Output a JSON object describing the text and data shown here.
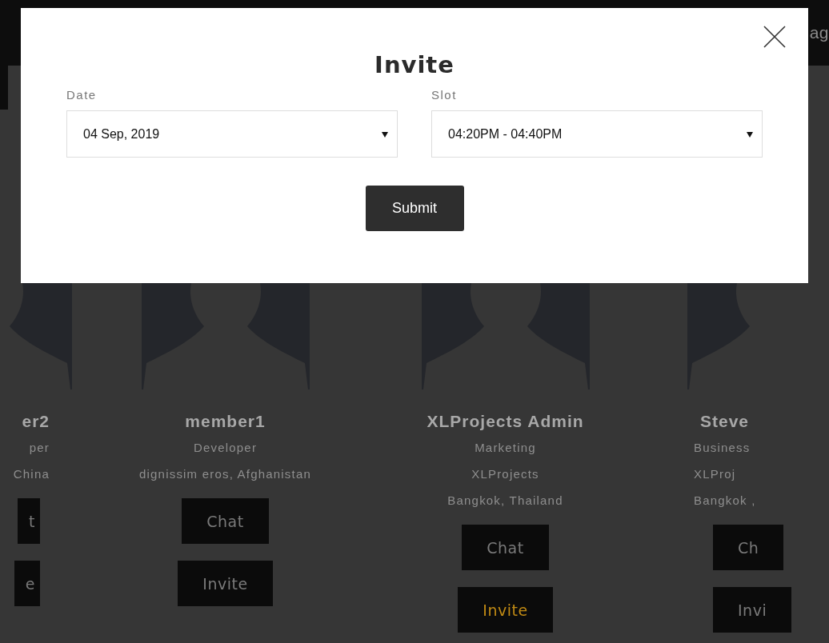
{
  "header": {
    "text": "ag"
  },
  "cards": [
    {
      "kind": "cut-left",
      "name": "er2",
      "lines": [
        "per",
        "China"
      ],
      "buttons": [
        {
          "label": "t",
          "selected": false
        },
        {
          "label": "e",
          "selected": false
        }
      ]
    },
    {
      "kind": "full",
      "name": "member1",
      "lines": [
        "Developer",
        "dignissim eros, Afghanistan"
      ],
      "buttons": [
        {
          "label": "Chat",
          "selected": false
        },
        {
          "label": "Invite",
          "selected": false
        }
      ]
    },
    {
      "kind": "full",
      "name": "XLProjects Admin",
      "lines": [
        "Marketing",
        "XLProjects",
        "Bangkok, Thailand"
      ],
      "buttons": [
        {
          "label": "Chat",
          "selected": false
        },
        {
          "label": "Invite",
          "selected": true
        }
      ]
    },
    {
      "kind": "cut-right",
      "name": "Steve",
      "lines": [
        "Business",
        "XLProj",
        "Bangkok ,"
      ],
      "buttons": [
        {
          "label": "Ch",
          "selected": false
        },
        {
          "label": "Invi",
          "selected": false
        }
      ]
    }
  ],
  "modal": {
    "title": "Invite",
    "fields": [
      {
        "label": "Date",
        "value": "04 Sep, 2019"
      },
      {
        "label": "Slot",
        "value": "04:20PM - 04:40PM"
      }
    ],
    "submit": "Submit"
  }
}
